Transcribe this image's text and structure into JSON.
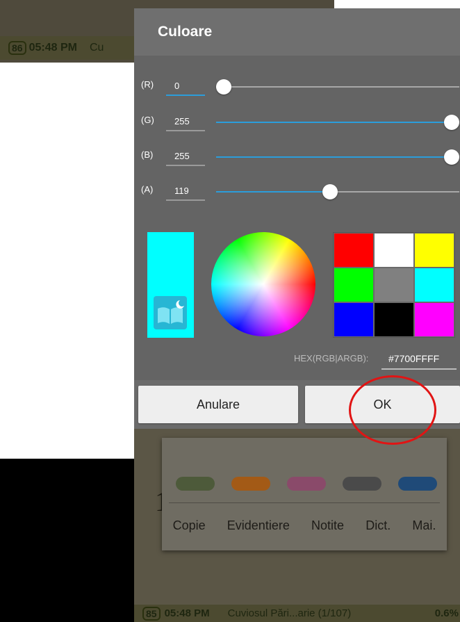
{
  "status_top": {
    "battery": "86",
    "time": "05:48 PM",
    "title_fragment": "Cu"
  },
  "status_bottom": {
    "battery": "85",
    "time": "05:48 PM",
    "title": "Cuviosul Pări...arie (1/107)",
    "percent": "0.6%"
  },
  "background_page": {
    "big_number": "1"
  },
  "selection_menu": {
    "swatch_colors": [
      "#4d5a3a",
      "#a35a16",
      "#8a4a6a",
      "#4a4a4a",
      "#1f4a78"
    ],
    "actions": [
      "Copie",
      "Evidentiere",
      "Notite",
      "Dict.",
      "Mai."
    ]
  },
  "dialog": {
    "title": "Culoare",
    "channels": [
      {
        "label": "(R)",
        "value": "0",
        "level": 0.0,
        "active": true
      },
      {
        "label": "(G)",
        "value": "255",
        "level": 1.0,
        "active": false
      },
      {
        "label": "(B)",
        "value": "255",
        "level": 1.0,
        "active": false
      },
      {
        "label": "(A)",
        "value": "119",
        "level": 0.467,
        "active": false
      }
    ],
    "preview_color": "#00ffff",
    "palette": [
      "#ff0000",
      "#ffffff",
      "#ffff00",
      "#00ff00",
      "#808080",
      "#00ffff",
      "#0000ff",
      "#000000",
      "#ff00ff"
    ],
    "hex_label": "HEX(RGB|ARGB):",
    "hex_value": "#7700FFFF",
    "cancel_label": "Anulare",
    "ok_label": "OK"
  },
  "colors": {
    "accent": "#2b9ddb",
    "annotation": "#e11414"
  }
}
